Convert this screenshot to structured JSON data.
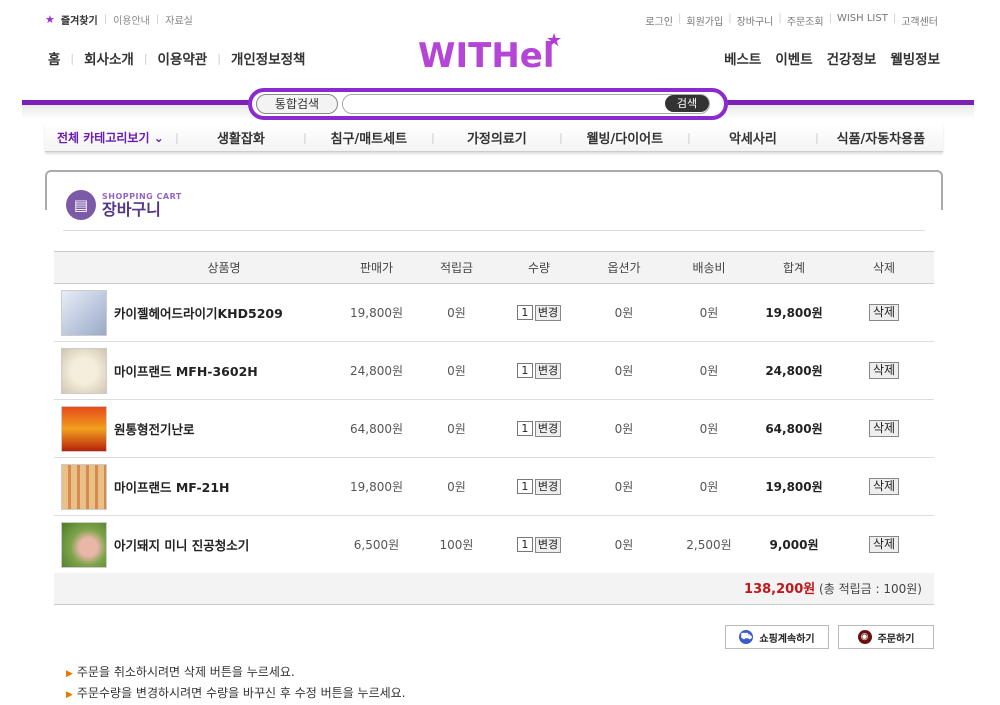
{
  "util_left": {
    "favorites": "즐겨찾기",
    "guide": "이용안내",
    "library": "자료실"
  },
  "util_right": [
    "로그인",
    "회원가입",
    "장바구니",
    "주문조회",
    "WISH LIST",
    "고객센터"
  ],
  "nav_left": [
    "홈",
    "회사소개",
    "이용약관",
    "개인정보정책"
  ],
  "nav_right": [
    "베스트",
    "이벤트",
    "건강정보",
    "웰빙정보"
  ],
  "logo": {
    "text": "WITHel"
  },
  "search": {
    "scope": "통합검색",
    "button": "검색",
    "value": ""
  },
  "categories": {
    "all": "전체 카테고리보기",
    "items": [
      "생활잡화",
      "침구/매트세트",
      "가정의료기",
      "웰빙/다이어트",
      "악세사리",
      "식품/자동차용품"
    ]
  },
  "cart_header": {
    "sub": "SHOPPING CART",
    "title": "장바구니"
  },
  "table": {
    "headers": [
      "상품명",
      "판매가",
      "적립금",
      "수량",
      "옵션가",
      "배송비",
      "합계",
      "삭제"
    ],
    "rows": [
      {
        "name": "카이젤헤어드라이기KHD5209",
        "price": "19,800원",
        "points": "0원",
        "qty": "1",
        "option": "0원",
        "shipping": "0원",
        "total": "19,800원"
      },
      {
        "name": "마이프랜드 MFH-3602H",
        "price": "24,800원",
        "points": "0원",
        "qty": "1",
        "option": "0원",
        "shipping": "0원",
        "total": "24,800원"
      },
      {
        "name": "원통형전기난로",
        "price": "64,800원",
        "points": "0원",
        "qty": "1",
        "option": "0원",
        "shipping": "0원",
        "total": "64,800원"
      },
      {
        "name": "마이프랜드 MF-21H",
        "price": "19,800원",
        "points": "0원",
        "qty": "1",
        "option": "0원",
        "shipping": "0원",
        "total": "19,800원"
      },
      {
        "name": "아기돼지 미니 진공청소기",
        "price": "6,500원",
        "points": "100원",
        "qty": "1",
        "option": "0원",
        "shipping": "2,500원",
        "total": "9,000원"
      }
    ],
    "change_label": "변경",
    "delete_label": "삭제"
  },
  "total": {
    "amount": "138,200원",
    "points": "(총 적립금 : 100원)"
  },
  "buttons": {
    "continue": "쇼핑계속하기",
    "order": "주문하기"
  },
  "notes": [
    "주문을 취소하시려면 삭제 버튼을 누르세요.",
    "주문수량을 변경하시려면 수량을 바꾸신 후 수정 버튼을 누르세요."
  ]
}
